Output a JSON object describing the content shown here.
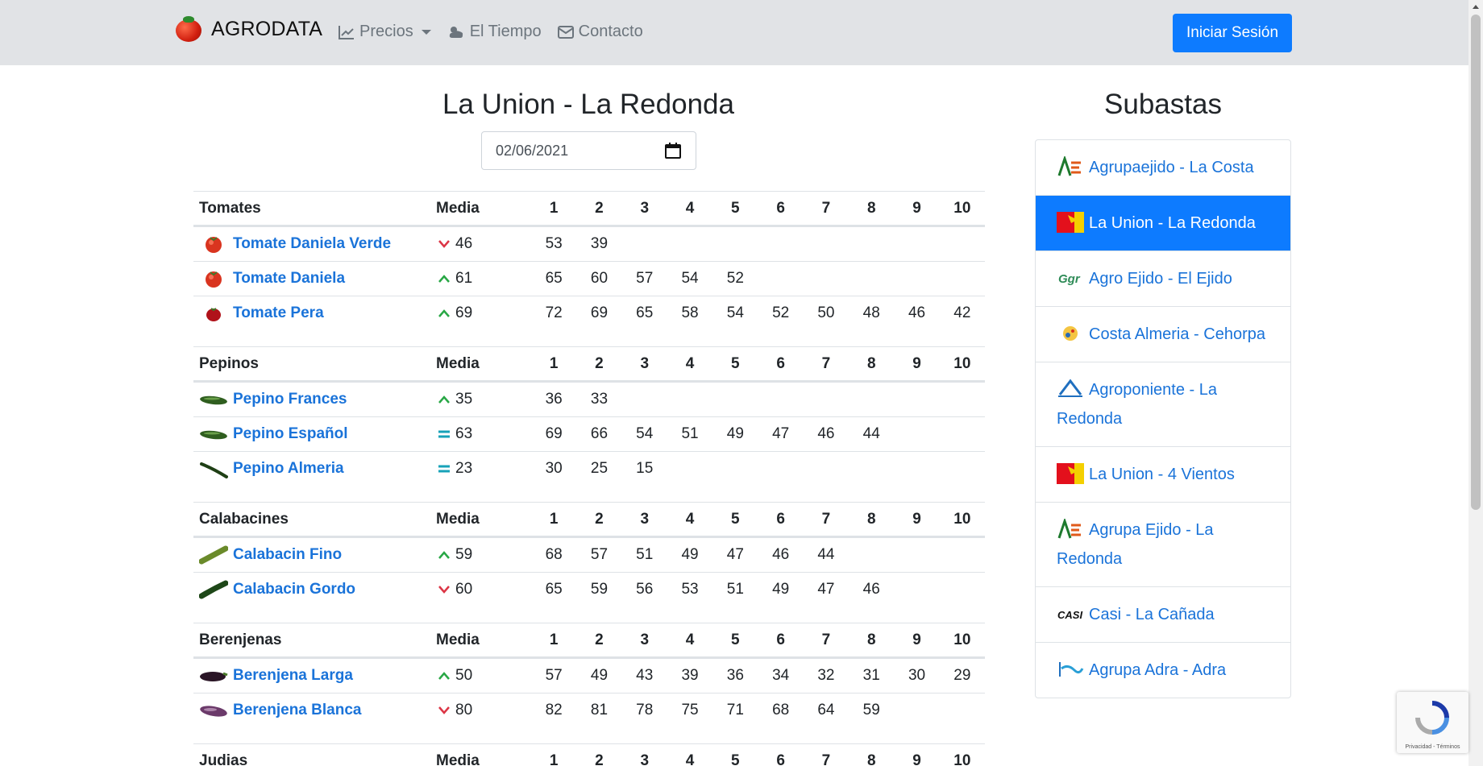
{
  "navbar": {
    "brand": "AGRODATA",
    "links": [
      {
        "label": "Precios",
        "icon": "chart-line-icon"
      },
      {
        "label": "El Tiempo",
        "icon": "cloud-sun-icon"
      },
      {
        "label": "Contacto",
        "icon": "envelope-icon"
      }
    ],
    "login_label": "Iniciar Sesión"
  },
  "main": {
    "title": "La Union - La Redonda",
    "date": "02/06/2021",
    "columns": [
      "Media",
      "1",
      "2",
      "3",
      "4",
      "5",
      "6",
      "7",
      "8",
      "9",
      "10"
    ],
    "groups": [
      {
        "name": "Tomates",
        "products": [
          {
            "name": "Tomate Daniela Verde",
            "icon": "tomato",
            "trend": "down",
            "media": "46",
            "values": [
              "53",
              "39"
            ]
          },
          {
            "name": "Tomate Daniela",
            "icon": "tomato",
            "trend": "up",
            "media": "61",
            "values": [
              "65",
              "60",
              "57",
              "54",
              "52"
            ]
          },
          {
            "name": "Tomate Pera",
            "icon": "tomato-pear",
            "trend": "up",
            "media": "69",
            "values": [
              "72",
              "69",
              "65",
              "58",
              "54",
              "52",
              "50",
              "48",
              "46",
              "42"
            ]
          }
        ]
      },
      {
        "name": "Pepinos",
        "products": [
          {
            "name": "Pepino Frances",
            "icon": "cucumber",
            "trend": "up",
            "media": "35",
            "values": [
              "36",
              "33"
            ]
          },
          {
            "name": "Pepino Español",
            "icon": "cucumber",
            "trend": "eq",
            "media": "63",
            "values": [
              "69",
              "66",
              "54",
              "51",
              "49",
              "47",
              "46",
              "44"
            ]
          },
          {
            "name": "Pepino Almeria",
            "icon": "cucumber-thin",
            "trend": "eq",
            "media": "23",
            "values": [
              "30",
              "25",
              "15"
            ]
          }
        ]
      },
      {
        "name": "Calabacines",
        "products": [
          {
            "name": "Calabacin Fino",
            "icon": "zucchini",
            "trend": "up",
            "media": "59",
            "values": [
              "68",
              "57",
              "51",
              "49",
              "47",
              "46",
              "44"
            ]
          },
          {
            "name": "Calabacin Gordo",
            "icon": "zucchini-dark",
            "trend": "down",
            "media": "60",
            "values": [
              "65",
              "59",
              "56",
              "53",
              "51",
              "49",
              "47",
              "46"
            ]
          }
        ]
      },
      {
        "name": "Berenjenas",
        "products": [
          {
            "name": "Berenjena Larga",
            "icon": "eggplant",
            "trend": "up",
            "media": "50",
            "values": [
              "57",
              "49",
              "43",
              "39",
              "36",
              "34",
              "32",
              "31",
              "30",
              "29"
            ]
          },
          {
            "name": "Berenjena Blanca",
            "icon": "eggplant-white",
            "trend": "down",
            "media": "80",
            "values": [
              "82",
              "81",
              "78",
              "75",
              "71",
              "68",
              "64",
              "59"
            ]
          }
        ]
      },
      {
        "name": "Judias",
        "products": []
      }
    ]
  },
  "sidebar": {
    "title": "Subastas",
    "items": [
      {
        "label": "Agrupaejido - La Costa",
        "logo": "agrupaejido-logo",
        "active": false
      },
      {
        "label": "La Union - La Redonda",
        "logo": "la-union-logo",
        "active": true
      },
      {
        "label": "Agro Ejido - El Ejido",
        "logo": "agro-ejido-logo",
        "active": false
      },
      {
        "label": "Costa Almeria - Cehorpa",
        "logo": "costa-almeria-logo",
        "active": false
      },
      {
        "label": "Agroponiente - La Redonda",
        "logo": "agroponiente-logo",
        "active": false
      },
      {
        "label": "La Union - 4 Vientos",
        "logo": "la-union-logo",
        "active": false
      },
      {
        "label": "Agrupa Ejido - La Redonda",
        "logo": "agrupaejido-logo",
        "active": false
      },
      {
        "label": "Casi - La Cañada",
        "logo": "casi-logo",
        "active": false
      },
      {
        "label": "Agrupa Adra - Adra",
        "logo": "agrupa-adra-logo",
        "active": false
      }
    ]
  },
  "recaptcha": {
    "text": "Privacidad - Términos"
  },
  "colors": {
    "primary": "#0d7bff",
    "link": "#1a73d9",
    "up": "#28a745",
    "down": "#dc3545",
    "equal": "#17a2b8"
  }
}
